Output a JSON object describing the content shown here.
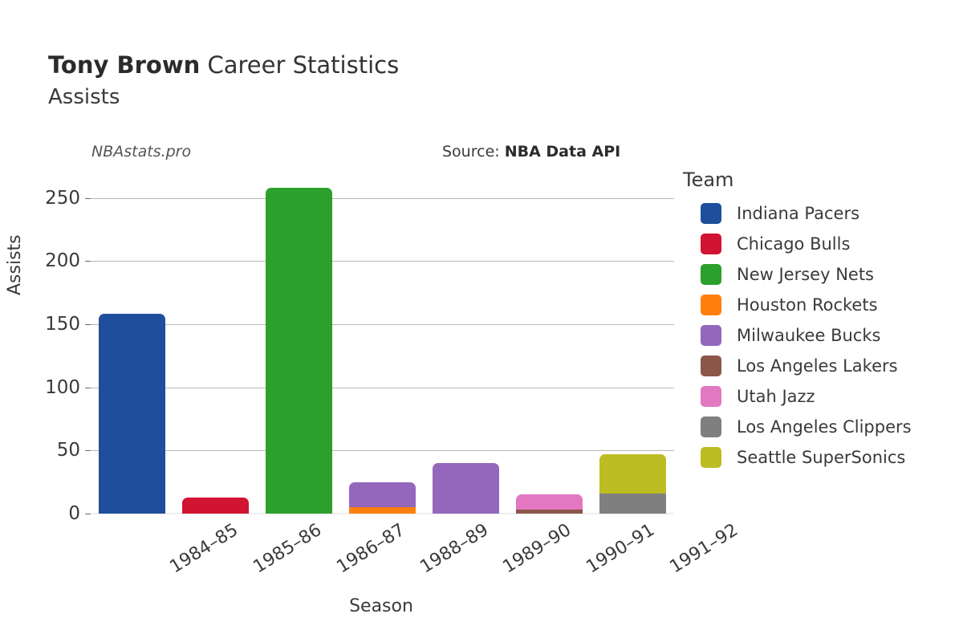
{
  "header": {
    "title_strong": "Tony Brown",
    "title_rest": " Career Statistics",
    "subtitle": "Assists",
    "watermark": "NBAstats.pro",
    "source_label": "Source: ",
    "source_value": "NBA Data API"
  },
  "legend": {
    "title": "Team",
    "items": [
      {
        "label": "Indiana Pacers",
        "color": "#1f4e9c"
      },
      {
        "label": "Chicago Bulls",
        "color": "#d11432"
      },
      {
        "label": "New Jersey Nets",
        "color": "#2ca02c"
      },
      {
        "label": "Houston Rockets",
        "color": "#ff7f0e"
      },
      {
        "label": "Milwaukee Bucks",
        "color": "#9467bd"
      },
      {
        "label": "Los Angeles Lakers",
        "color": "#8c564b"
      },
      {
        "label": "Utah Jazz",
        "color": "#e377c2"
      },
      {
        "label": "Los Angeles Clippers",
        "color": "#7f7f7f"
      },
      {
        "label": "Seattle SuperSonics",
        "color": "#bcbd22"
      }
    ]
  },
  "chart_data": {
    "type": "bar",
    "title": "Tony Brown Career Statistics",
    "subtitle": "Assists",
    "stacked": true,
    "xlabel": "Season",
    "ylabel": "Assists",
    "ylim": [
      0,
      265
    ],
    "yticks": [
      0,
      50,
      100,
      150,
      200,
      250
    ],
    "ytick_labels": [
      "0",
      "50",
      "100",
      "150",
      "200",
      "250"
    ],
    "grid": "horizontal",
    "legend_position": "right",
    "categories": [
      "1984–85",
      "1985–86",
      "1986–87",
      "1988–89",
      "1989–90",
      "1990–91",
      "1991–92"
    ],
    "series": [
      {
        "name": "Indiana Pacers",
        "color": "#1f4e9c",
        "values": [
          158,
          0,
          0,
          0,
          0,
          0,
          0
        ]
      },
      {
        "name": "Chicago Bulls",
        "color": "#d11432",
        "values": [
          0,
          13,
          0,
          0,
          0,
          0,
          0
        ]
      },
      {
        "name": "New Jersey Nets",
        "color": "#2ca02c",
        "values": [
          0,
          0,
          258,
          0,
          0,
          0,
          0
        ]
      },
      {
        "name": "Houston Rockets",
        "color": "#ff7f0e",
        "values": [
          0,
          0,
          0,
          5,
          0,
          0,
          0
        ]
      },
      {
        "name": "Milwaukee Bucks",
        "color": "#9467bd",
        "values": [
          0,
          0,
          0,
          20,
          40,
          0,
          0
        ]
      },
      {
        "name": "Los Angeles Lakers",
        "color": "#8c564b",
        "values": [
          0,
          0,
          0,
          0,
          0,
          3,
          0
        ]
      },
      {
        "name": "Utah Jazz",
        "color": "#e377c2",
        "values": [
          0,
          0,
          0,
          0,
          0,
          12,
          0
        ]
      },
      {
        "name": "Los Angeles Clippers",
        "color": "#7f7f7f",
        "values": [
          0,
          0,
          0,
          0,
          0,
          0,
          16
        ]
      },
      {
        "name": "Seattle SuperSonics",
        "color": "#bcbd22",
        "values": [
          0,
          0,
          0,
          0,
          0,
          0,
          31
        ]
      }
    ],
    "totals": [
      158,
      13,
      258,
      25,
      40,
      15,
      47
    ]
  }
}
